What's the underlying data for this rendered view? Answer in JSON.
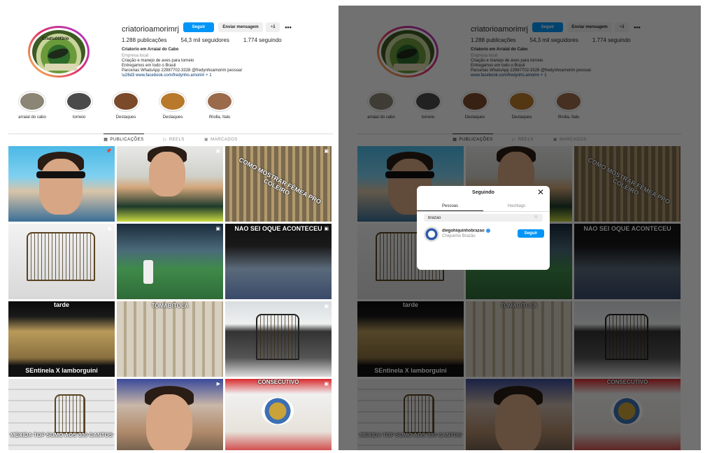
{
  "profile": {
    "username": "criatorioamorimrj",
    "follow_label": "Seguir",
    "message_label": "Enviar mensagem",
    "suggest_label": "+å",
    "more_label": "•••",
    "posts": "1.288 publicações",
    "followers": "54,3 mil seguidores",
    "following": "1.774 seguindo",
    "bio_name": "Criatorio em Arraial do Cabo",
    "category": "Empresa local",
    "bio_lines": [
      "Criação e manejo de aves para torneio",
      "Entregamos em todo o Brasil",
      "Parcerias WhatsApp 22987702-3328 @fredynhoamorim pessoal"
    ],
    "link": "www.facebook.com/fredynho.amorim + 1"
  },
  "highlights": [
    {
      "label": "arraial do cabo",
      "color": "#8a8575"
    },
    {
      "label": "torneio",
      "color": "#4a4a4a"
    },
    {
      "label": "Destaques",
      "color": "#7a4a2a"
    },
    {
      "label": "Destaques",
      "color": "#b87a2a"
    },
    {
      "label": "Ifriolla, Italu",
      "color": "#9a6a4a"
    }
  ],
  "tabs": [
    {
      "label": "PUBLICAÇÕES",
      "icon": "grid-icon",
      "glyph": "▦"
    },
    {
      "label": "REELS",
      "icon": "reels-icon",
      "glyph": "▷"
    },
    {
      "label": "MARCADOS",
      "icon": "tagged-icon",
      "glyph": "▣"
    }
  ],
  "grid": [
    {
      "overlay": "",
      "icon": "📌"
    },
    {
      "overlay": "",
      "icon": "▣"
    },
    {
      "overlay": "COMO MOSTRAR FÊMEA PRO COLEIRO",
      "icon": "▣"
    },
    {
      "overlay": "",
      "icon": "▣"
    },
    {
      "overlay": "",
      "icon": "▣"
    },
    {
      "overlay": "NAO SEI OQUE ACONTECEU",
      "icon": "▣"
    },
    {
      "overlay": "tarde",
      "overlay2": "SEntinela X lamborguini",
      "icon": ""
    },
    {
      "overlay": "TOMABITOLÁ",
      "icon": ""
    },
    {
      "overlay": "",
      "icon": "▣"
    },
    {
      "overlay": "MEXIDA TOP SUMO AOS 300 CANTOS",
      "icon": ""
    },
    {
      "overlay": "",
      "icon": "▶"
    },
    {
      "overlay": "CONSECUTIVO",
      "icon": "▣"
    }
  ],
  "modal": {
    "title": "Seguindo",
    "close": "✕",
    "tab_people": "Pessoas",
    "tab_hashtags": "Hashtags",
    "search_value": "brazao",
    "clear": "⊗",
    "result_username": "diegohiquinhobrazao",
    "result_name": "Chiquinho Brazão",
    "result_follow": "Seguir"
  }
}
